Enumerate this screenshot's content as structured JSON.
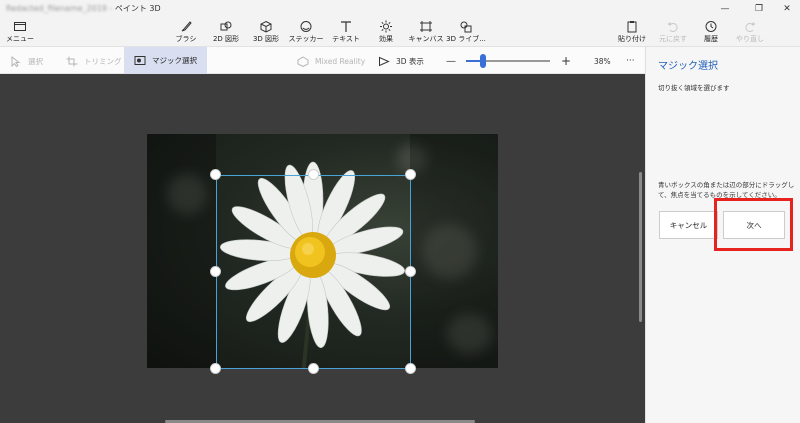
{
  "window": {
    "title_blurred": "Redacted_filename_2019 - ",
    "title": "ペイント 3D",
    "controls": [
      "—",
      "❐",
      "✕"
    ]
  },
  "ribbon": {
    "menu_label": "メニュー",
    "tools": [
      {
        "label": "ブラシ",
        "icon": "brush-icon"
      },
      {
        "label": "2D 図形",
        "icon": "2d-shapes-icon"
      },
      {
        "label": "3D 図形",
        "icon": "3d-shapes-icon"
      },
      {
        "label": "ステッカー",
        "icon": "stickers-icon"
      },
      {
        "label": "テキスト",
        "icon": "text-icon"
      },
      {
        "label": "効果",
        "icon": "effects-icon"
      },
      {
        "label": "キャンバス",
        "icon": "canvas-icon"
      },
      {
        "label": "3D ライブ...",
        "icon": "3d-library-icon"
      }
    ],
    "right": [
      {
        "label": "貼り付け",
        "icon": "paste-icon",
        "enabled": true
      },
      {
        "label": "元に戻す",
        "icon": "undo-icon",
        "enabled": false
      },
      {
        "label": "履歴",
        "icon": "history-icon",
        "enabled": true
      },
      {
        "label": "やり直し",
        "icon": "redo-icon",
        "enabled": false
      }
    ]
  },
  "subbar": {
    "select": "選択",
    "crop": "トリミング",
    "magic_select": "マジック選択",
    "mixed_reality": "Mixed Reality",
    "view_3d": "3D 表示",
    "zoom_minus": "—",
    "zoom_plus": "+",
    "zoom_level": "38%",
    "zoom_fraction": 0.2,
    "more": "···"
  },
  "panel": {
    "title": "マジック選択",
    "subtitle": "切り抜く領域を選びます",
    "instruction": "青いボックスの角または辺の部分にドラッグして、焦点を当てるものを示してください。",
    "cancel": "キャンセル",
    "next": "次へ"
  },
  "colors": {
    "accent": "#1f5fb8",
    "highlight": "#e6231f",
    "selection": "#4aa3d8"
  }
}
